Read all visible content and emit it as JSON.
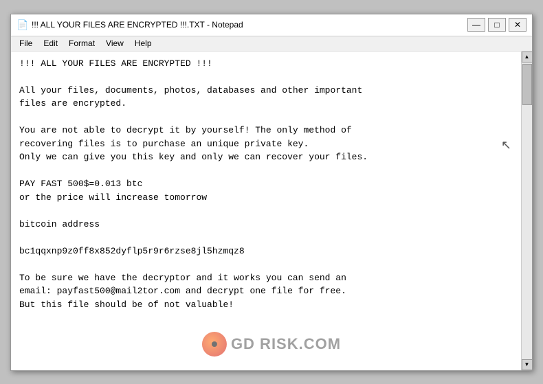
{
  "window": {
    "title": "!!! ALL YOUR FILES ARE ENCRYPTED !!!.TXT - Notepad",
    "title_icon": "📄"
  },
  "menu": {
    "items": [
      "File",
      "Edit",
      "Format",
      "View",
      "Help"
    ]
  },
  "controls": {
    "minimize": "—",
    "maximize": "□",
    "close": "✕"
  },
  "content": {
    "text": "!!! ALL YOUR FILES ARE ENCRYPTED !!!\n\nAll your files, documents, photos, databases and other important\nfiles are encrypted.\n\nYou are not able to decrypt it by yourself! The only method of\nrecovering files is to purchase an unique private key.\nOnly we can give you this key and only we can recover your files.\n\nPAY FAST 500$=0.013 btc\nor the price will increase tomorrow\n\nbitcoin address\n\nbc1qqxnp9z0ff8x852dyflp5r9r6rzse8jl5hzmqz8\n\nTo be sure we have the decryptor and it works you can send an\nemail: payfast500@mail2tor.com and decrypt one file for free.\nBut this file should be of not valuable!"
  },
  "watermark": {
    "text": "GD RISK.COM"
  }
}
